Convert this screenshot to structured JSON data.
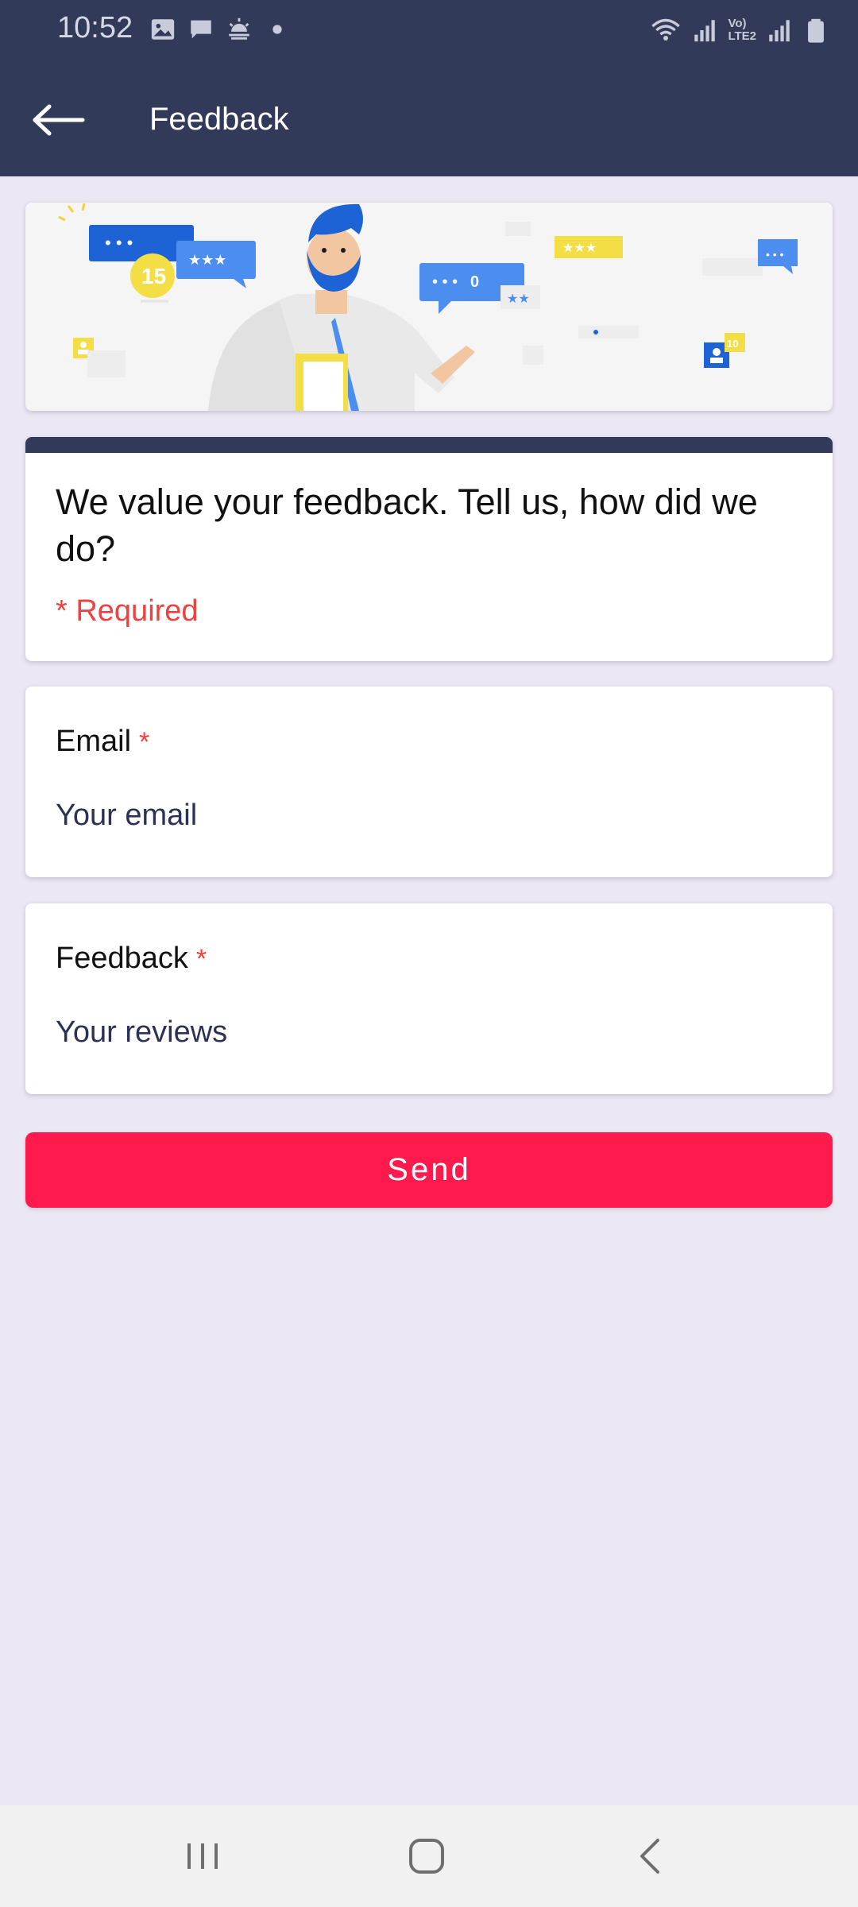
{
  "status_bar": {
    "time": "10:52",
    "left_icons": [
      "gallery-icon",
      "message-icon",
      "weather-icon",
      "dot-icon"
    ],
    "right_icons": [
      "wifi-icon",
      "signal-icon",
      "volte-lte2-icon",
      "signal-icon",
      "battery-icon"
    ],
    "network_label_top": "Vo)",
    "network_label_bottom": "LTE2"
  },
  "app_bar": {
    "title": "Feedback",
    "back_icon": "arrow-left-icon"
  },
  "banner": {
    "badge_number": "15",
    "bubble_count": "0",
    "small_badge": "10"
  },
  "intro": {
    "title": "We value your feedback. Tell us, how did we do?",
    "required_text": "* Required"
  },
  "email_field": {
    "label": "Email",
    "required_mark": "*",
    "placeholder": "Your email",
    "value": ""
  },
  "feedback_field": {
    "label": "Feedback",
    "required_mark": "*",
    "placeholder": "Your reviews",
    "value": ""
  },
  "send_button": {
    "label": "Send"
  },
  "nav_bar": {
    "icons": [
      "recent-apps-icon",
      "home-icon",
      "back-icon"
    ]
  },
  "colors": {
    "header": "#323A59",
    "background": "#ECE7F4",
    "accent": "#FF1A4E",
    "required": "#F04040"
  }
}
